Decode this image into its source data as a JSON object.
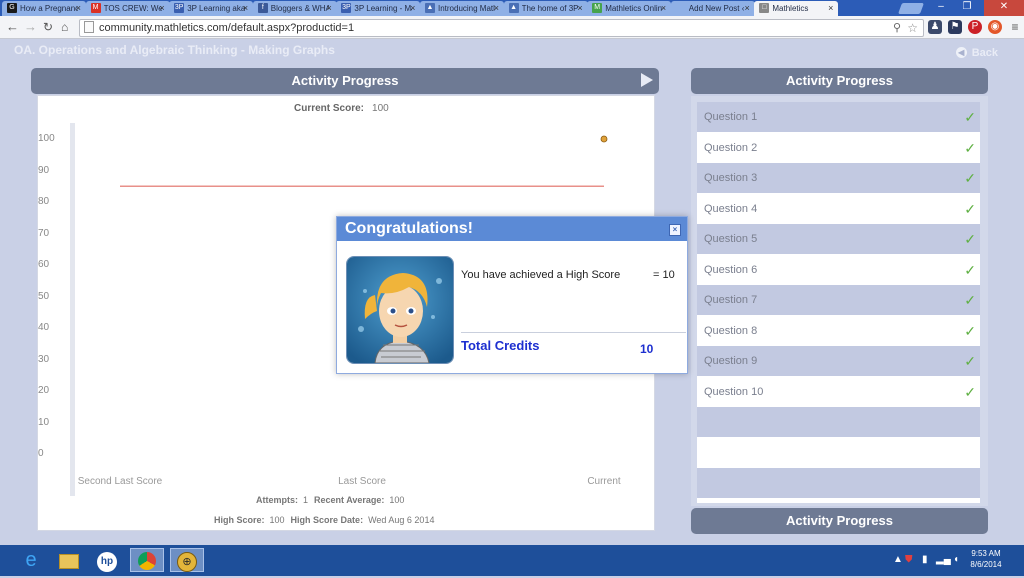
{
  "browser": {
    "tabs": [
      {
        "label": "How a Pregnanc",
        "icon": "G",
        "color": "#1a1a1a"
      },
      {
        "label": "TOS CREW: Wel",
        "icon": "M",
        "color": "#d93025"
      },
      {
        "label": "3P Learning aka",
        "icon": "3P",
        "color": "#3a5fb0"
      },
      {
        "label": "Bloggers & WHA",
        "icon": "f",
        "color": "#3b5998"
      },
      {
        "label": "3P Learning - Ma",
        "icon": "3P",
        "color": "#3a5fb0"
      },
      {
        "label": "Introducing Matl",
        "icon": "▲",
        "color": "#4a6fb5"
      },
      {
        "label": "The home of 3P",
        "icon": "▲",
        "color": "#4a6fb5"
      },
      {
        "label": "Mathletics Onlin",
        "icon": "M",
        "color": "#46a34d"
      },
      {
        "label": "Add New Post ‹ F",
        "icon": "",
        "color": "#8fb0e6"
      },
      {
        "label": "Mathletics",
        "icon": "□",
        "color": "#888888"
      }
    ],
    "url": "community.mathletics.com/default.aspx?productid=1"
  },
  "page": {
    "title": "OA.  Operations and Algebraic Thinking - Making Graphs",
    "back_label": "Back"
  },
  "chart_panel": {
    "header": "Activity Progress",
    "current_score_label": "Current Score:",
    "current_score_value": "100",
    "attempts_label": "Attempts:",
    "attempts_value": "1",
    "recent_average_label": "Recent Average:",
    "recent_average_value": "100",
    "high_score_label": "High Score:",
    "high_score_value": "100",
    "high_score_date_label": "High Score Date:",
    "high_score_date_value": "Wed Aug 6 2014"
  },
  "chart_data": {
    "type": "line",
    "categories": [
      "Second Last Score",
      "Last Score",
      "Current"
    ],
    "yticks": [
      0,
      10,
      20,
      30,
      40,
      50,
      60,
      70,
      80,
      90,
      100
    ],
    "ylim": [
      0,
      100
    ],
    "points": [
      {
        "x": "Current",
        "y": 100
      }
    ],
    "reference_line": {
      "y": 85,
      "color": "#e8908a"
    },
    "grid": false
  },
  "questions_panel": {
    "header": "Activity Progress",
    "footer": "Activity Progress",
    "items": [
      {
        "label": "Question 1",
        "status": "✓"
      },
      {
        "label": "Question 2",
        "status": "✓"
      },
      {
        "label": "Question 3",
        "status": "✓"
      },
      {
        "label": "Question 4",
        "status": "✓"
      },
      {
        "label": "Question 5",
        "status": "✓"
      },
      {
        "label": "Question 6",
        "status": "✓"
      },
      {
        "label": "Question 7",
        "status": "✓"
      },
      {
        "label": "Question 8",
        "status": "✓"
      },
      {
        "label": "Question 9",
        "status": "✓"
      },
      {
        "label": "Question 10",
        "status": "✓"
      }
    ]
  },
  "modal": {
    "title": "Congratulations!",
    "close_icon": "×",
    "message": "You have achieved a High Score",
    "message_value": "= 10",
    "total_label": "Total Credits",
    "total_value": "10"
  },
  "taskbar": {
    "time": "9:53 AM",
    "date": "8/6/2014"
  }
}
